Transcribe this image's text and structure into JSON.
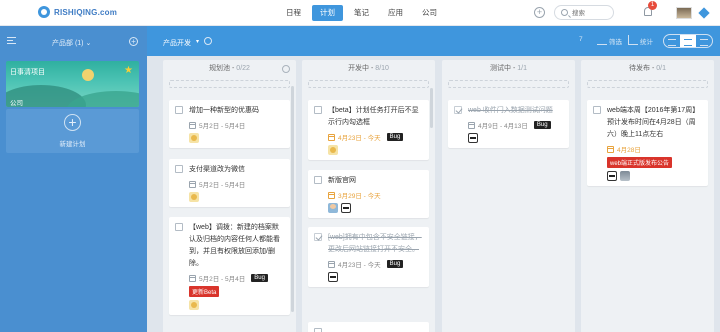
{
  "header": {
    "brand": "RISHIQING.com",
    "nav": [
      {
        "label": "日程",
        "active": false
      },
      {
        "label": "计划",
        "active": true
      },
      {
        "label": "笔记",
        "active": false
      },
      {
        "label": "应用",
        "active": false
      },
      {
        "label": "公司",
        "active": false
      }
    ],
    "search_placeholder": "搜索",
    "notification_count": "1"
  },
  "sidebar": {
    "title": "产品部 (1)",
    "caret": "⌄",
    "add_symbol": "+",
    "project": {
      "title": "日事清项目",
      "subtitle": "公司"
    },
    "new_project_label": "新建计划",
    "new_project_symbol": "+"
  },
  "toolbar": {
    "board_title": "产品开发",
    "caret": "▾",
    "member_count": "7",
    "filter_label": "筛选",
    "stats_label": "统计"
  },
  "columns": [
    {
      "name": "规划池",
      "count": "0/22",
      "cards": [
        {
          "title": "增加一种新型的优惠码",
          "date": "5月2日 - 5月4日",
          "done": false,
          "overdue": false,
          "bug": false,
          "tag": "",
          "avatars": [
            "chick"
          ]
        },
        {
          "title": "支付渠道改为微信",
          "date": "5月2日 - 5月4日",
          "done": false,
          "overdue": false,
          "bug": false,
          "tag": "",
          "avatars": [
            "chick"
          ]
        },
        {
          "title": "【web】调拨：新建的档案默认及归档的内容任何人都能看到，并且有权限放回添加/删除。",
          "date": "5月2日 - 5月4日",
          "done": false,
          "overdue": false,
          "bug": true,
          "tag": "更新Beta",
          "avatars": [
            "chick"
          ]
        }
      ]
    },
    {
      "name": "开发中",
      "count": "8/10",
      "cards": [
        {
          "title": "【beta】计划任务打开后不显示行内勾选框",
          "date": "4月23日 - 今天",
          "done": false,
          "overdue": true,
          "bug": true,
          "tag": "",
          "avatars": [
            "chick"
          ]
        },
        {
          "title": "新版官网",
          "date": "3月29日 - 今天",
          "done": false,
          "overdue": true,
          "bug": false,
          "tag": "",
          "avatars": [
            "boy",
            "panda"
          ]
        },
        {
          "title": "[web]拥有中包含不安全链接，更改后网站链接打开不安全。",
          "date": "4月23日 - 今天",
          "done": true,
          "overdue": false,
          "bug": true,
          "tag": "",
          "avatars": [
            "panda"
          ]
        }
      ]
    },
    {
      "name": "测试中",
      "count": "1/1",
      "cards": [
        {
          "title": "web 收件门入数据测试问题",
          "date": "4月9日 - 4月13日",
          "done": true,
          "overdue": false,
          "bug": true,
          "tag": "",
          "avatars": [
            "panda"
          ]
        }
      ]
    },
    {
      "name": "待发布",
      "count": "0/1",
      "cards": [
        {
          "title": "web端本周【2016年第17周】预计发布时间在4月28日（周六）晚上11点左右",
          "date": "4月28日",
          "done": false,
          "overdue": true,
          "bug": false,
          "tag": "web端正式版发布公告",
          "avatars": [
            "panda",
            "photo"
          ]
        }
      ]
    }
  ],
  "bug_label": "Bug",
  "colors": {
    "accent": "#3f96dd",
    "sidebar": "#4a8fd0",
    "overdue": "#e8a33d",
    "tag": "#d9342b"
  }
}
